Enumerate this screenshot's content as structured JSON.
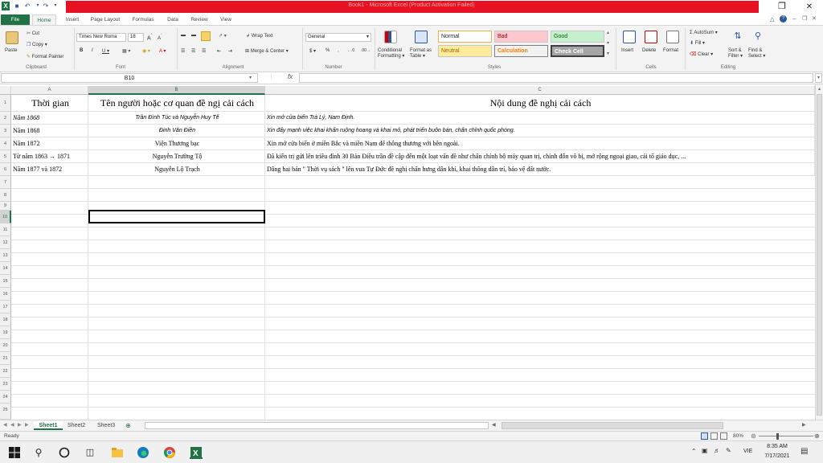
{
  "window": {
    "title": "Book1 - Microsoft Excel (Product Activation Failed)",
    "accent_color": "#217346",
    "title_bar_color": "#e81123"
  },
  "ribbon_tabs": [
    {
      "label": "File"
    },
    {
      "label": "Home"
    },
    {
      "label": "Insert"
    },
    {
      "label": "Page Layout"
    },
    {
      "label": "Formulas"
    },
    {
      "label": "Data"
    },
    {
      "label": "Review"
    },
    {
      "label": "View"
    }
  ],
  "clipboard": {
    "cut": "Cut",
    "copy": "Copy",
    "paste": "Paste",
    "format_painter": "Format Painter",
    "group": "Clipboard"
  },
  "font": {
    "name": "Times New Roma",
    "size": "18",
    "group": "Font"
  },
  "alignment": {
    "wrap_text": "Wrap Text",
    "merge_center": "Merge & Center",
    "group": "Alignment"
  },
  "number": {
    "format": "General",
    "currency": "$",
    "percent": "%",
    "comma": ",",
    "group": "Number"
  },
  "styles": {
    "conditional_formatting_1": "Conditional",
    "conditional_formatting_2": "Formatting",
    "format_as_table_1": "Format as",
    "format_as_table_2": "Table",
    "normal": "Normal",
    "bad": "Bad",
    "good": "Good",
    "neutral": "Neutral",
    "calculation": "Calculation",
    "check_cell": "Check Cell",
    "group": "Styles"
  },
  "cells_group": {
    "insert": "Insert",
    "delete": "Delete",
    "format": "Format",
    "group": "Cells"
  },
  "editing": {
    "autosum": "AutoSum",
    "fill": "Fill",
    "clear": "Clear",
    "sort_filter_1": "Sort &",
    "sort_filter_2": "Filter",
    "find_select_1": "Find &",
    "find_select_2": "Select",
    "group": "Editing"
  },
  "formula_bar": {
    "name_box": "B10",
    "fx": "fx",
    "value": ""
  },
  "grid": {
    "columns": [
      "A",
      "B",
      "C"
    ],
    "row_numbers": [
      "1",
      "2",
      "3",
      "4",
      "5",
      "6",
      "7",
      "8",
      "9",
      "10",
      "11",
      "12",
      "13",
      "14",
      "15",
      "16",
      "17",
      "18",
      "19",
      "20",
      "21",
      "22",
      "23",
      "24",
      "25"
    ],
    "header": {
      "a": "Thời gian",
      "b": "Tên người hoặc cơ quan đề ngị cải cách",
      "c": "Nội dung đề nghị cải cách"
    },
    "rows": [
      {
        "a": "Năm 1868",
        "b": "Trần Đình Túc và Nguyễn Huy Tế",
        "c": "Xin mở cửa biển Trà Lý, Nam Định."
      },
      {
        "a": "Năm 1868",
        "b": "Đinh Văn Điền",
        "c": "Xin đẩy mạnh việc khai khẩn ruộng hoang và khai mỏ, phát triển buôn bán, chấn chỉnh quốc phòng."
      },
      {
        "a": "Năm 1872",
        "b": "Viện Thương bạc",
        "c": "Xin mở cửa biển ở miền Bắc và miền Nam để thông thương với bên ngoài."
      },
      {
        "a": "Từ năm 1863 → 1871",
        "b": "Nguyễn Trường Tộ",
        "c": "Đã kiến trị gửi lên triều đình 30 Bản Điều trần đề cập đến một loạt vấn đề như chấn chỉnh bộ máy quan trị, chỉnh đốn võ bị, mở rộng ngoại giao, cải tổ giáo dục, ..."
      },
      {
        "a": "Năm 1877 và 1872",
        "b": "Nguyễn Lộ Trạch",
        "c": "Dâng hai bản \" Thời vụ sách \" lên vua Tự Đức đề nghị chấn hưng dân khí, khai thông dân trí, bảo vệ đất nước."
      }
    ]
  },
  "sheets": [
    {
      "label": "Sheet1"
    },
    {
      "label": "Sheet2"
    },
    {
      "label": "Sheet3"
    }
  ],
  "status": {
    "ready": "Ready",
    "zoom": "80%"
  },
  "taskbar": {
    "language": "VIE",
    "time": "8:35 AM",
    "date": "7/17/2021"
  }
}
